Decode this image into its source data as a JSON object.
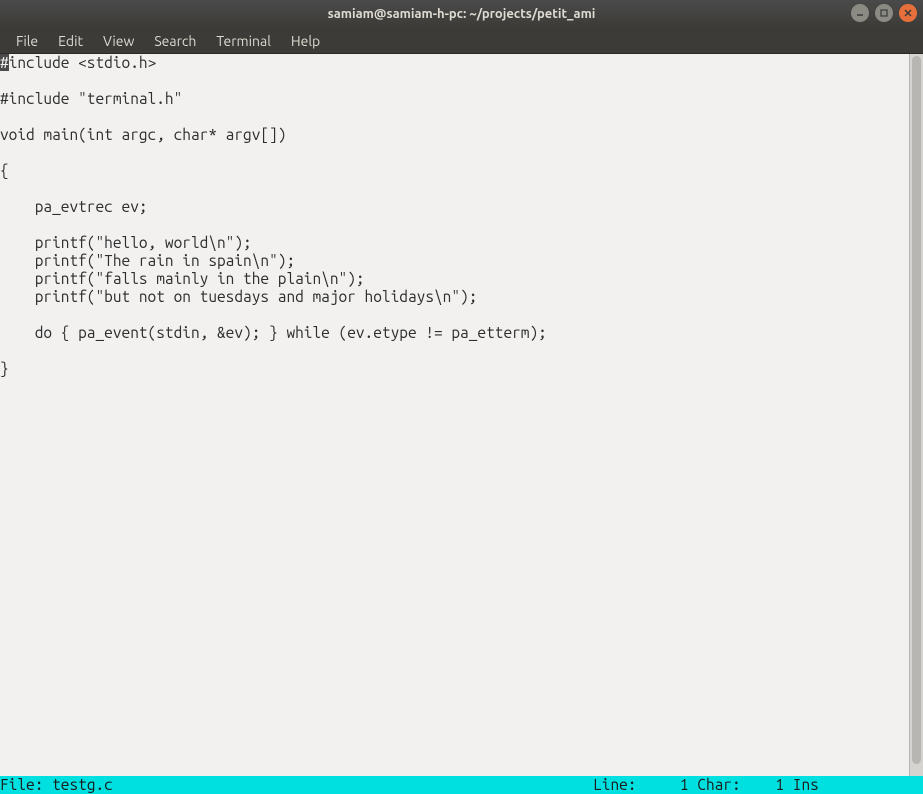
{
  "window": {
    "title": "samiam@samiam-h-pc: ~/projects/petit_ami"
  },
  "menubar": {
    "items": [
      "File",
      "Edit",
      "View",
      "Search",
      "Terminal",
      "Help"
    ]
  },
  "editor": {
    "cursor_char": "#",
    "lines_after_cursor": "include <stdio.h>\n\n#include \"terminal.h\"\n\nvoid main(int argc, char* argv[])\n\n{\n\n    pa_evtrec ev;\n\n    printf(\"hello, world\\n\");\n    printf(\"The rain in spain\\n\");\n    printf(\"falls mainly in the plain\\n\");\n    printf(\"but not on tuesdays and major holidays\\n\");\n\n    do { pa_event(stdin, &ev); } while (ev.etype != pa_etterm);\n\n}"
  },
  "statusbar": {
    "file_label": "File: ",
    "file_name": "testg.c",
    "line_label": "Line:",
    "line_value": "1",
    "char_label": "Char:",
    "char_value": "1",
    "mode": "Ins"
  }
}
